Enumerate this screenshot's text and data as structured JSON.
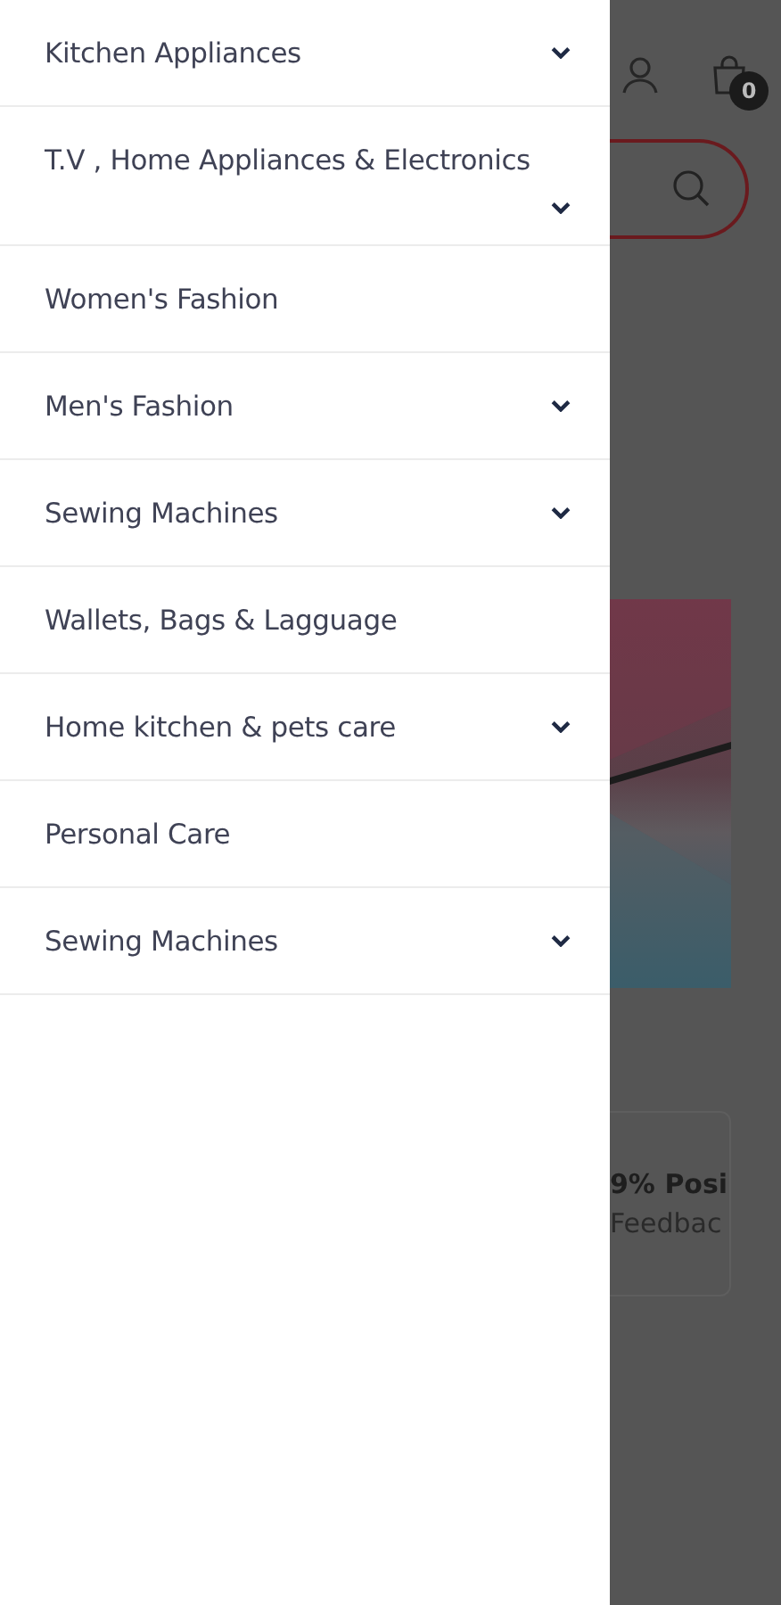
{
  "menu": [
    {
      "label": "Kitchen Appliances",
      "expandable": true
    },
    {
      "label": "T.V , Home Appliances & Electronics",
      "expandable": true
    },
    {
      "label": "Women's Fashion",
      "expandable": false
    },
    {
      "label": "Men's Fashion",
      "expandable": true
    },
    {
      "label": "Sewing Machines",
      "expandable": true
    },
    {
      "label": "Wallets, Bags & Lagguage",
      "expandable": false
    },
    {
      "label": "Home kitchen & pets care",
      "expandable": true
    },
    {
      "label": "Personal Care",
      "expandable": false
    },
    {
      "label": "Sewing Machines",
      "expandable": true
    }
  ],
  "page": {
    "cart_count": "0",
    "feedback": {
      "title": "9% Posi",
      "subtitle": "Feedbac"
    }
  }
}
